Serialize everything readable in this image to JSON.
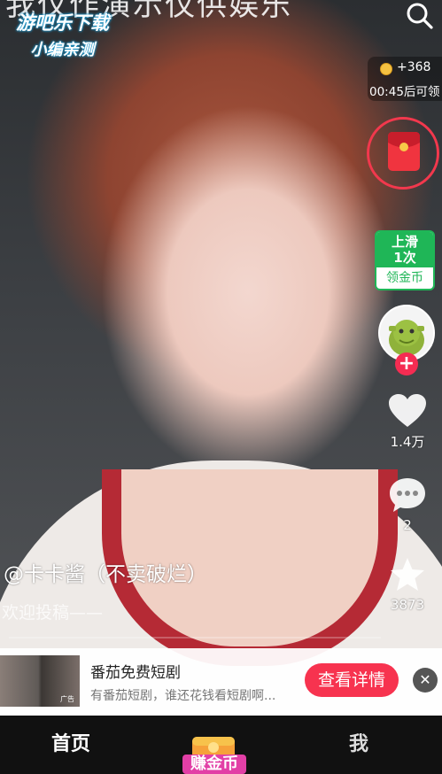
{
  "video": {
    "overlay_title": "我仅作演示仅供娱乐",
    "watermark_line1": "游吧乐下载",
    "watermark_line2": "小编亲测"
  },
  "reward": {
    "coins": "+368",
    "timer": "00:45后可领"
  },
  "swipe_task": {
    "line1": "上滑",
    "line2": "1次",
    "label": "领金币"
  },
  "actions": {
    "likes": "1.4万",
    "comments": "2",
    "favorites": "3873"
  },
  "post": {
    "author": "@卡卡酱（不卖破烂）",
    "caption": "欢迎投稿——",
    "progress": 0.0
  },
  "ad": {
    "title": "番茄免费短剧",
    "desc": "有番茄短剧，谁还花钱看短剧啊...",
    "cta": "查看详情",
    "thumb_tag": "广告",
    "close": "✕"
  },
  "tabbar": {
    "home": "首页",
    "earn": "赚金币",
    "me": "我"
  },
  "colors": {
    "accent_red": "#f52c52",
    "green": "#1fb657",
    "earn_pink": "#e23fa6"
  }
}
